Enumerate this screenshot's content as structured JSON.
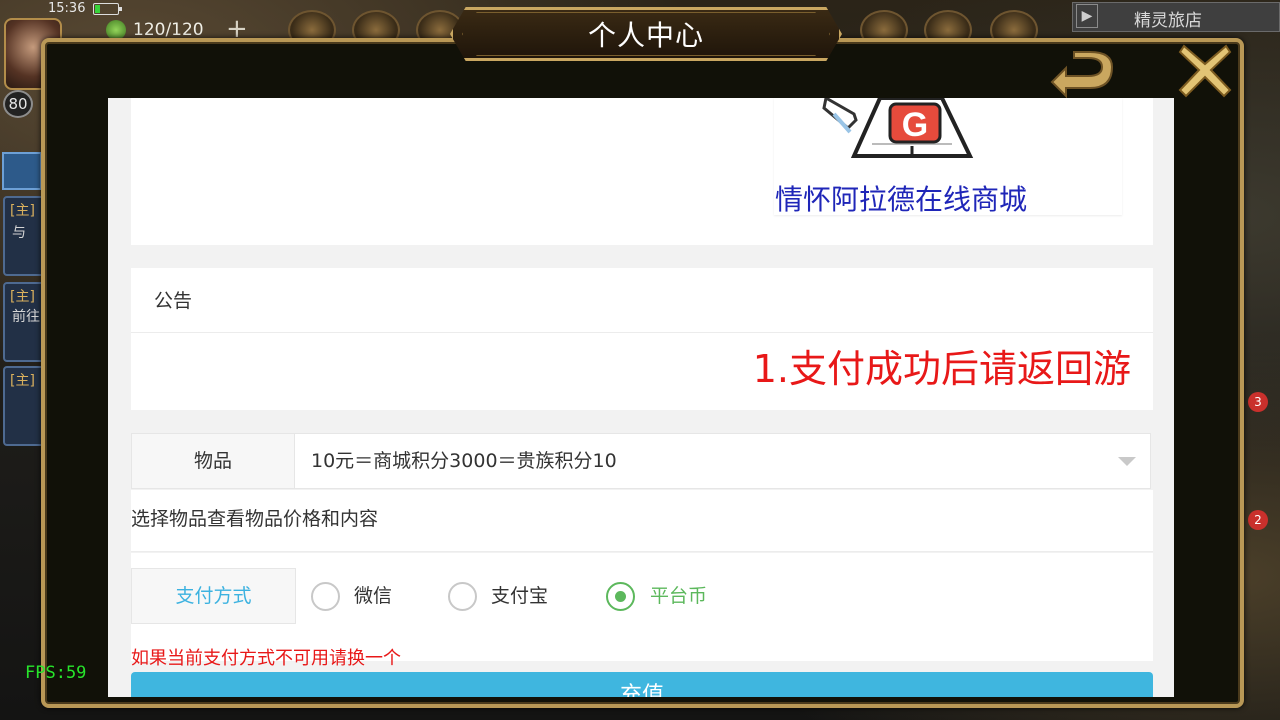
{
  "status_bar": {
    "clock": "15:36",
    "energy": "120/120",
    "plus": "+",
    "level": "80"
  },
  "hud": {
    "shop_label": "精灵旅店",
    "shop_arrow": "▶",
    "fps": "FPS:59",
    "quests": [
      {
        "tag": "[主]",
        "text": "与"
      },
      {
        "tag": "[主]",
        "text": "前往"
      },
      {
        "tag": "[主]",
        "text": ""
      }
    ],
    "badges": [
      "3",
      "2"
    ]
  },
  "modal": {
    "title": "个人中心",
    "back_icon": "back-arrow-icon",
    "close_icon": "close-x-icon",
    "colors": {
      "gold": "#c9a761",
      "frame": "#111108"
    }
  },
  "mall": {
    "logo_letter": "G",
    "name": "情怀阿拉德在线商城"
  },
  "notice": {
    "title": "公告",
    "text": "1.支付成功后请返回游"
  },
  "item": {
    "label": "物品",
    "selected": "10元＝商城积分3000＝贵族积分10",
    "hint": "选择物品查看物品价格和内容"
  },
  "payment": {
    "label": "支付方式",
    "options": [
      {
        "label": "微信",
        "checked": false
      },
      {
        "label": "支付宝",
        "checked": false
      },
      {
        "label": "平台币",
        "checked": true
      }
    ],
    "warning": "如果当前支付方式不可用请换一个",
    "colors": {
      "selected": "#5cb85c",
      "label": "#3cb2e0",
      "warning": "#e81818"
    }
  },
  "submit": {
    "label": "充值"
  }
}
